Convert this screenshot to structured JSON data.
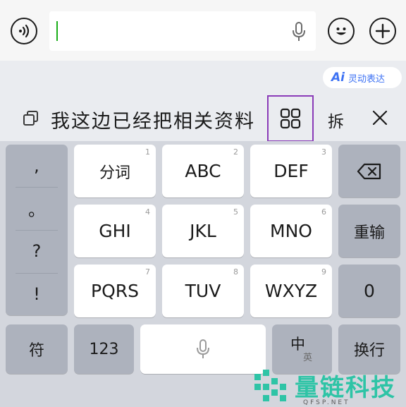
{
  "input_bar": {
    "voice_icon": "voice-wave-icon",
    "text_value": "",
    "mic_icon": "microphone-icon",
    "emoji_icon": "smiley-face-icon",
    "plus_icon": "plus-icon"
  },
  "toolbar": {
    "ai_mark": "Ai",
    "ai_label": "灵动表达",
    "copy_icon": "copy-icon",
    "candidate_text": "我这边已经把相关资料",
    "grid_icon": "grid-icon",
    "split_label": "拆",
    "close_icon": "close-icon"
  },
  "keyboard": {
    "punctuation": [
      ",",
      "。",
      "?",
      "!"
    ],
    "keys": [
      {
        "label": "分词",
        "num": "1"
      },
      {
        "label": "ABC",
        "num": "2"
      },
      {
        "label": "DEF",
        "num": "3"
      },
      {
        "label": "GHI",
        "num": "4"
      },
      {
        "label": "JKL",
        "num": "5"
      },
      {
        "label": "MNO",
        "num": "6"
      },
      {
        "label": "PQRS",
        "num": "7"
      },
      {
        "label": "TUV",
        "num": "8"
      },
      {
        "label": "WXYZ",
        "num": "9"
      }
    ],
    "backspace_icon": "backspace-icon",
    "reenter_label": "重输",
    "zero_label": "0",
    "symbol_label": "符",
    "numeric_label": "123",
    "space_mic_icon": "microphone-icon",
    "lang_zh": "中",
    "lang_en": "英",
    "enter_label": "换行"
  },
  "watermark": {
    "name": "量链科技",
    "domain": "QFSP.NET"
  },
  "colors": {
    "caret": "#1aad19",
    "ai_accent": "#3d72f4",
    "highlight_border": "#8a3bb8",
    "watermark": "#2ec4a6"
  }
}
